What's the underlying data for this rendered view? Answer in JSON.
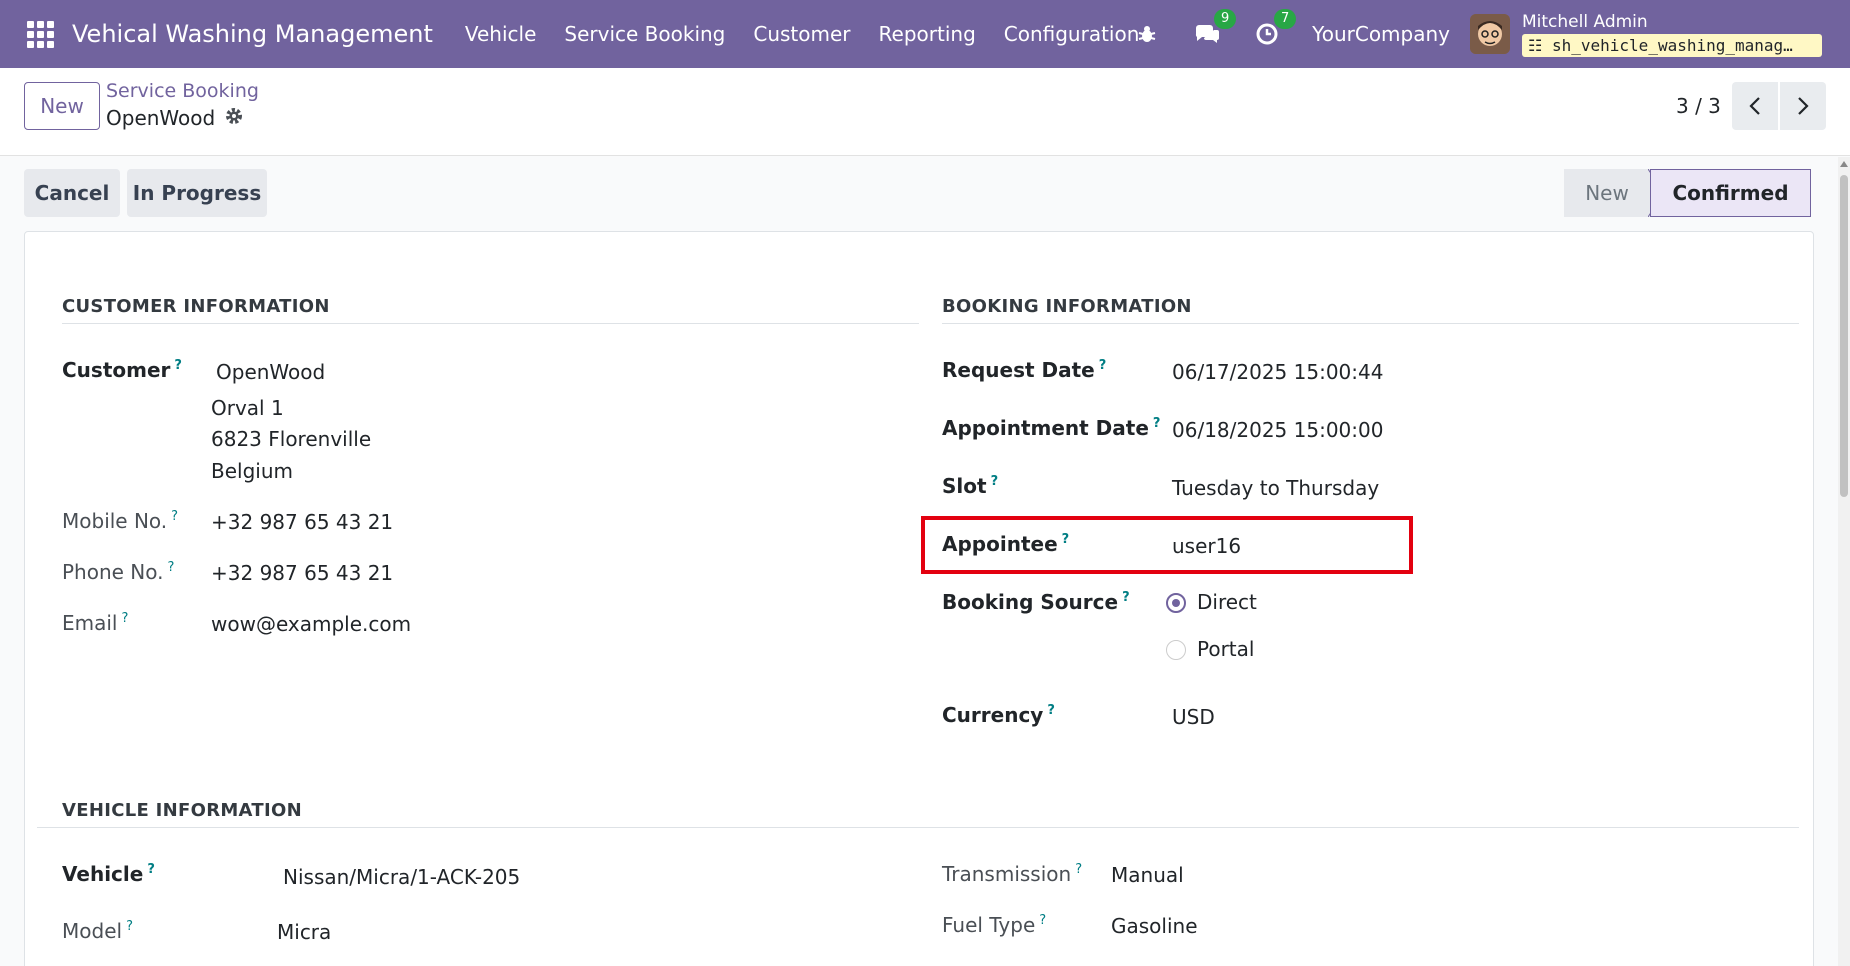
{
  "navbar": {
    "app_title": "Vehical Washing Management",
    "menu": [
      "Vehicle",
      "Service Booking",
      "Customer",
      "Reporting",
      "Configuration"
    ],
    "messages_count": "9",
    "activities_count": "7",
    "company": "YourCompany",
    "user_name": "Mitchell Admin",
    "database": "sh_vehicle_washing_manag…"
  },
  "control": {
    "new_label": "New",
    "breadcrumb_parent": "Service Booking",
    "breadcrumb_current": "OpenWood",
    "pager": "3 / 3"
  },
  "actions": {
    "cancel_label": "Cancel",
    "in_progress_label": "In Progress"
  },
  "statusbar": {
    "stages": [
      "New",
      "Confirmed"
    ],
    "active": "Confirmed"
  },
  "customer_info": {
    "title": "CUSTOMER INFORMATION",
    "customer_label": "Customer",
    "customer_name": "OpenWood",
    "address_line1": "Orval 1",
    "address_line2": "6823 Florenville",
    "address_line3": "Belgium",
    "mobile_label": "Mobile No.",
    "mobile": "+32 987 65 43 21",
    "phone_label": "Phone No.",
    "phone": "+32 987 65 43 21",
    "email_label": "Email",
    "email": "wow@example.com"
  },
  "booking_info": {
    "title": "BOOKING INFORMATION",
    "request_date_label": "Request Date",
    "request_date": "06/17/2025 15:00:44",
    "appointment_date_label": "Appointment Date",
    "appointment_date": "06/18/2025 15:00:00",
    "slot_label": "Slot",
    "slot": "Tuesday to Thursday",
    "appointee_label": "Appointee",
    "appointee": "user16",
    "booking_source_label": "Booking Source",
    "source_options": [
      "Direct",
      "Portal"
    ],
    "source_selected": "Direct",
    "currency_label": "Currency",
    "currency": "USD"
  },
  "vehicle_info": {
    "title": "VEHICLE INFORMATION",
    "vehicle_label": "Vehicle",
    "vehicle": "Nissan/Micra/1-ACK-205",
    "model_label": "Model",
    "model": "Micra",
    "transmission_label": "Transmission",
    "transmission": "Manual",
    "fuel_type_label": "Fuel Type",
    "fuel_type": "Gasoline"
  },
  "colors": {
    "brand": "#71639e",
    "highlight": "#e3000f",
    "badge": "#28a745"
  }
}
